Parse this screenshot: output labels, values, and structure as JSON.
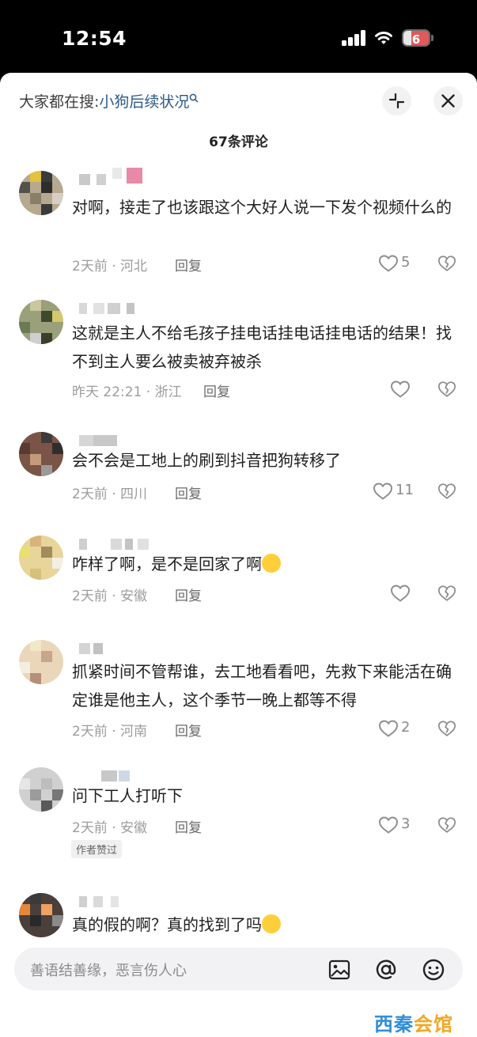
{
  "status_bar": {
    "time": "12:54",
    "battery": "6"
  },
  "header": {
    "search_prefix": "大家都在搜:",
    "search_term": "小狗后续状况",
    "comment_count": "67条评论"
  },
  "comments": [
    {
      "text": "对啊，接走了也该跟这个大好人说一下发个视频什么的",
      "time": "2天前",
      "location": "河北",
      "reply": "回复",
      "likes": "5"
    },
    {
      "text": "这就是主人不给毛孩子挂电话挂电话挂电话的结果！找不到主人要么被卖被弃被杀",
      "time": "昨天 22:21",
      "location": "浙江",
      "reply": "回复",
      "likes": ""
    },
    {
      "text": "会不会是工地上的刷到抖音把狗转移了",
      "time": "2天前",
      "location": "四川",
      "reply": "回复",
      "likes": "11"
    },
    {
      "text": "咋样了啊，是不是回家了啊",
      "time": "2天前",
      "location": "安徽",
      "reply": "回复",
      "likes": ""
    },
    {
      "text": "抓紧时间不管帮谁，去工地看看吧，先救下来能活在确定谁是他主人，这个季节一晚上都等不得",
      "time": "2天前",
      "location": "河南",
      "reply": "回复",
      "likes": "2"
    },
    {
      "text": "问下工人打听下",
      "time": "2天前",
      "location": "安徽",
      "reply": "回复",
      "likes": "3",
      "badge": "作者赞过"
    },
    {
      "text": "真的假的啊？真的找到了吗"
    }
  ],
  "input": {
    "placeholder": "善语结善缘，恶言伤人心"
  },
  "meta_sep": " · ",
  "watermark": {
    "part1": "西秦",
    "part2": "会馆"
  },
  "icons": [
    "search-icon",
    "collapse-icon",
    "close-icon",
    "heart-icon",
    "broken-heart-icon",
    "image-icon",
    "at-icon",
    "emoji-icon"
  ],
  "colors": {
    "search_term": "#2a5a8a",
    "watermark": "#f3a722"
  }
}
